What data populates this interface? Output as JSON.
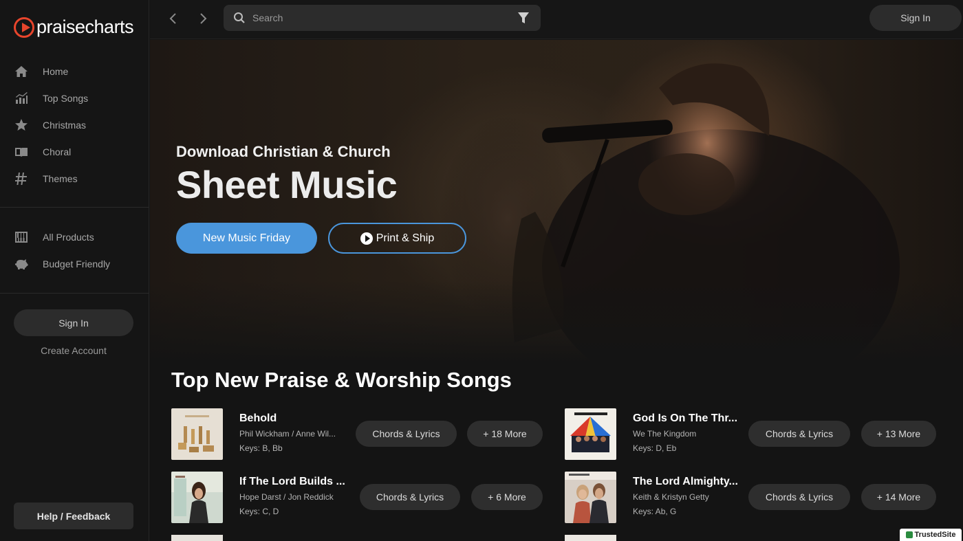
{
  "brand": {
    "name": "praisecharts"
  },
  "sidebar": {
    "primary": [
      {
        "label": "Home",
        "icon": "home-icon"
      },
      {
        "label": "Top Songs",
        "icon": "chart-icon"
      },
      {
        "label": "Christmas",
        "icon": "star-icon"
      },
      {
        "label": "Choral",
        "icon": "book-icon"
      },
      {
        "label": "Themes",
        "icon": "hash-icon"
      }
    ],
    "secondary": [
      {
        "label": "All Products",
        "icon": "piano-icon"
      },
      {
        "label": "Budget Friendly",
        "icon": "piggy-bank-icon"
      }
    ],
    "sign_in": "Sign In",
    "create_account": "Create Account",
    "help": "Help / Feedback"
  },
  "topbar": {
    "search_placeholder": "Search",
    "sign_in": "Sign In"
  },
  "hero": {
    "subtitle": "Download Christian & Church",
    "title": "Sheet Music",
    "primary_button": "New Music Friday",
    "secondary_button": "Print & Ship"
  },
  "section": {
    "title": "Top New Praise & Worship Songs",
    "songs": [
      {
        "title": "Behold",
        "artist": "Phil Wickham / Anne Wil...",
        "keys": "Keys: B, Bb",
        "chords": "Chords & Lyrics",
        "more": "+ 18 More"
      },
      {
        "title": "God Is On The Thr...",
        "artist": "We The Kingdom",
        "keys": "Keys: D, Eb",
        "chords": "Chords & Lyrics",
        "more": "+ 13 More"
      },
      {
        "title": "If The Lord Builds ...",
        "artist": "Hope Darst / Jon Reddick",
        "keys": "Keys: C, D",
        "chords": "Chords & Lyrics",
        "more": "+ 6 More"
      },
      {
        "title": "The Lord Almighty...",
        "artist": "Keith & Kristyn Getty",
        "keys": "Keys: Ab, G",
        "chords": "Chords & Lyrics",
        "more": "+ 14 More"
      }
    ]
  },
  "badge": {
    "label": "TrustedSite"
  },
  "colors": {
    "accent": "#4a96dc",
    "brand": "#e8452c",
    "background": "#141414"
  }
}
